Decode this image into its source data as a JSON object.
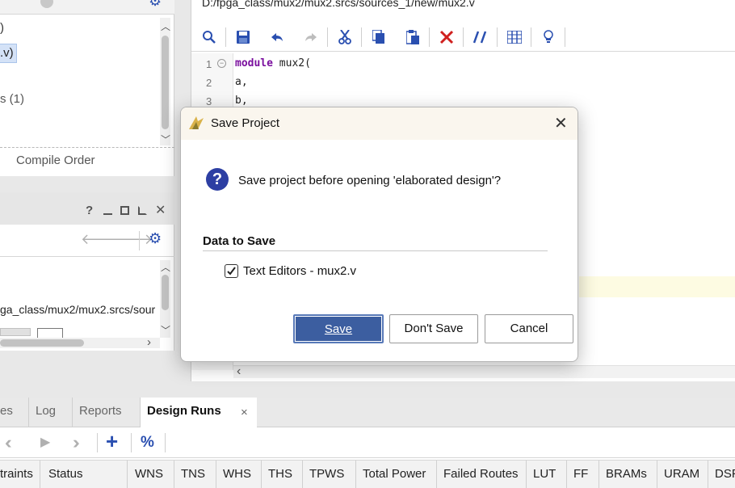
{
  "sources": {
    "tree_items": [
      ")",
      ".v)",
      "s (1)"
    ],
    "compile_order_tab": "Compile Order"
  },
  "props": {
    "path_text": "ga_class/mux2/mux2.srcs/sour"
  },
  "editor": {
    "file_path": "D:/fpga_class/mux2/mux2.srcs/sources_1/new/mux2.v",
    "lines": [
      {
        "num": "1",
        "kw": "module",
        "text": " mux2("
      },
      {
        "num": "2",
        "kw": "",
        "text": "a,"
      },
      {
        "num": "3",
        "kw": "",
        "text": "b,"
      }
    ]
  },
  "dialog": {
    "title": "Save Project",
    "message": "Save project before opening 'elaborated design'?",
    "section_title": "Data to Save",
    "items": [
      {
        "label": "Text Editors - mux2.v",
        "checked": true
      }
    ],
    "buttons": {
      "save": "Save",
      "dont_save": "Don't Save",
      "cancel": "Cancel"
    }
  },
  "bottom": {
    "tabs": [
      "es",
      "Log",
      "Reports",
      "Design Runs"
    ],
    "active_tab": "Design Runs",
    "tab_close": "×",
    "columns": [
      "traints",
      "Status",
      "WNS",
      "TNS",
      "WHS",
      "THS",
      "TPWS",
      "Total Power",
      "Failed Routes",
      "LUT",
      "FF",
      "BRAMs",
      "URAM",
      "DSP"
    ]
  },
  "colors": {
    "accent": "#2a4fb0",
    "primary_button": "#3c5ea0",
    "close_red": "#d0201e",
    "question_icon": "#2d3fa3"
  }
}
